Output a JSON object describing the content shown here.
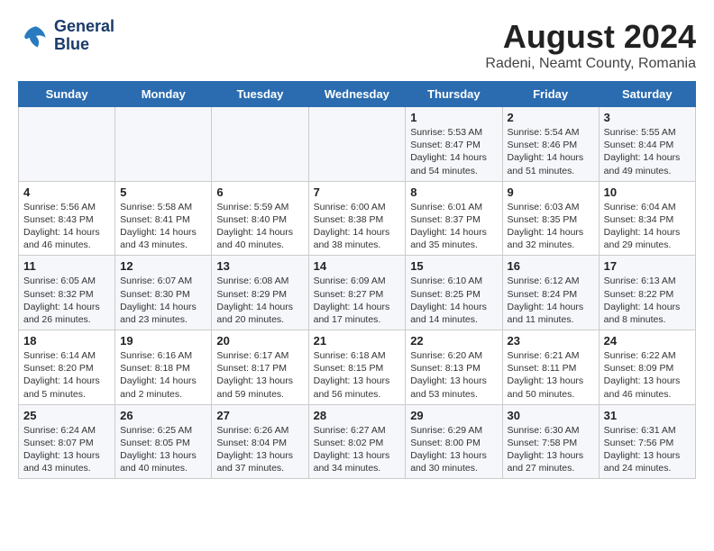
{
  "header": {
    "logo_line1": "General",
    "logo_line2": "Blue",
    "title": "August 2024",
    "subtitle": "Radeni, Neamt County, Romania"
  },
  "days_of_week": [
    "Sunday",
    "Monday",
    "Tuesday",
    "Wednesday",
    "Thursday",
    "Friday",
    "Saturday"
  ],
  "weeks": [
    [
      {
        "day": "",
        "info": ""
      },
      {
        "day": "",
        "info": ""
      },
      {
        "day": "",
        "info": ""
      },
      {
        "day": "",
        "info": ""
      },
      {
        "day": "1",
        "info": "Sunrise: 5:53 AM\nSunset: 8:47 PM\nDaylight: 14 hours and 54 minutes."
      },
      {
        "day": "2",
        "info": "Sunrise: 5:54 AM\nSunset: 8:46 PM\nDaylight: 14 hours and 51 minutes."
      },
      {
        "day": "3",
        "info": "Sunrise: 5:55 AM\nSunset: 8:44 PM\nDaylight: 14 hours and 49 minutes."
      }
    ],
    [
      {
        "day": "4",
        "info": "Sunrise: 5:56 AM\nSunset: 8:43 PM\nDaylight: 14 hours and 46 minutes."
      },
      {
        "day": "5",
        "info": "Sunrise: 5:58 AM\nSunset: 8:41 PM\nDaylight: 14 hours and 43 minutes."
      },
      {
        "day": "6",
        "info": "Sunrise: 5:59 AM\nSunset: 8:40 PM\nDaylight: 14 hours and 40 minutes."
      },
      {
        "day": "7",
        "info": "Sunrise: 6:00 AM\nSunset: 8:38 PM\nDaylight: 14 hours and 38 minutes."
      },
      {
        "day": "8",
        "info": "Sunrise: 6:01 AM\nSunset: 8:37 PM\nDaylight: 14 hours and 35 minutes."
      },
      {
        "day": "9",
        "info": "Sunrise: 6:03 AM\nSunset: 8:35 PM\nDaylight: 14 hours and 32 minutes."
      },
      {
        "day": "10",
        "info": "Sunrise: 6:04 AM\nSunset: 8:34 PM\nDaylight: 14 hours and 29 minutes."
      }
    ],
    [
      {
        "day": "11",
        "info": "Sunrise: 6:05 AM\nSunset: 8:32 PM\nDaylight: 14 hours and 26 minutes."
      },
      {
        "day": "12",
        "info": "Sunrise: 6:07 AM\nSunset: 8:30 PM\nDaylight: 14 hours and 23 minutes."
      },
      {
        "day": "13",
        "info": "Sunrise: 6:08 AM\nSunset: 8:29 PM\nDaylight: 14 hours and 20 minutes."
      },
      {
        "day": "14",
        "info": "Sunrise: 6:09 AM\nSunset: 8:27 PM\nDaylight: 14 hours and 17 minutes."
      },
      {
        "day": "15",
        "info": "Sunrise: 6:10 AM\nSunset: 8:25 PM\nDaylight: 14 hours and 14 minutes."
      },
      {
        "day": "16",
        "info": "Sunrise: 6:12 AM\nSunset: 8:24 PM\nDaylight: 14 hours and 11 minutes."
      },
      {
        "day": "17",
        "info": "Sunrise: 6:13 AM\nSunset: 8:22 PM\nDaylight: 14 hours and 8 minutes."
      }
    ],
    [
      {
        "day": "18",
        "info": "Sunrise: 6:14 AM\nSunset: 8:20 PM\nDaylight: 14 hours and 5 minutes."
      },
      {
        "day": "19",
        "info": "Sunrise: 6:16 AM\nSunset: 8:18 PM\nDaylight: 14 hours and 2 minutes."
      },
      {
        "day": "20",
        "info": "Sunrise: 6:17 AM\nSunset: 8:17 PM\nDaylight: 13 hours and 59 minutes."
      },
      {
        "day": "21",
        "info": "Sunrise: 6:18 AM\nSunset: 8:15 PM\nDaylight: 13 hours and 56 minutes."
      },
      {
        "day": "22",
        "info": "Sunrise: 6:20 AM\nSunset: 8:13 PM\nDaylight: 13 hours and 53 minutes."
      },
      {
        "day": "23",
        "info": "Sunrise: 6:21 AM\nSunset: 8:11 PM\nDaylight: 13 hours and 50 minutes."
      },
      {
        "day": "24",
        "info": "Sunrise: 6:22 AM\nSunset: 8:09 PM\nDaylight: 13 hours and 46 minutes."
      }
    ],
    [
      {
        "day": "25",
        "info": "Sunrise: 6:24 AM\nSunset: 8:07 PM\nDaylight: 13 hours and 43 minutes."
      },
      {
        "day": "26",
        "info": "Sunrise: 6:25 AM\nSunset: 8:05 PM\nDaylight: 13 hours and 40 minutes."
      },
      {
        "day": "27",
        "info": "Sunrise: 6:26 AM\nSunset: 8:04 PM\nDaylight: 13 hours and 37 minutes."
      },
      {
        "day": "28",
        "info": "Sunrise: 6:27 AM\nSunset: 8:02 PM\nDaylight: 13 hours and 34 minutes."
      },
      {
        "day": "29",
        "info": "Sunrise: 6:29 AM\nSunset: 8:00 PM\nDaylight: 13 hours and 30 minutes."
      },
      {
        "day": "30",
        "info": "Sunrise: 6:30 AM\nSunset: 7:58 PM\nDaylight: 13 hours and 27 minutes."
      },
      {
        "day": "31",
        "info": "Sunrise: 6:31 AM\nSunset: 7:56 PM\nDaylight: 13 hours and 24 minutes."
      }
    ]
  ]
}
